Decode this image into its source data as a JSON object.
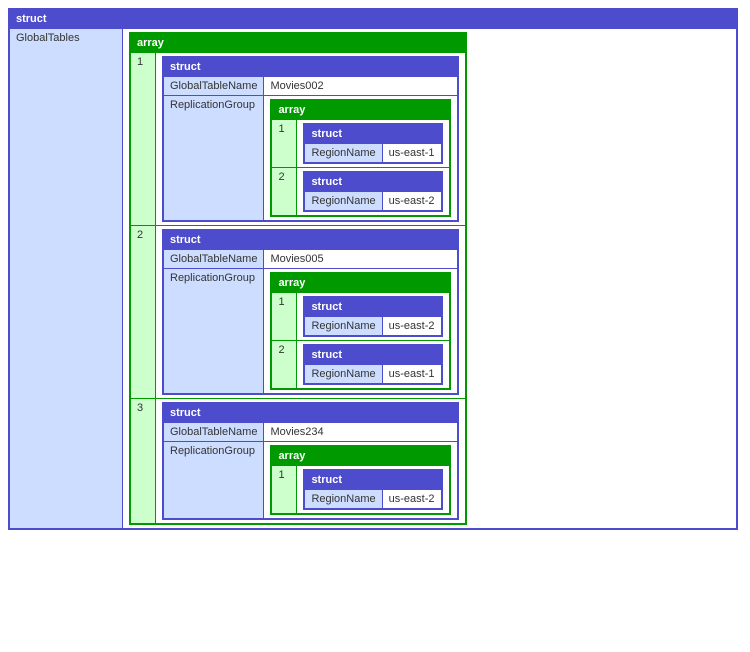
{
  "labels": {
    "struct": "struct",
    "array": "array",
    "globalTables": "GlobalTables",
    "globalTableName": "GlobalTableName",
    "replicationGroup": "ReplicationGroup",
    "regionName": "RegionName"
  },
  "idx": {
    "1": "1",
    "2": "2",
    "3": "3"
  },
  "tables": [
    {
      "name": "Movies002",
      "regions": [
        "us-east-1",
        "us-east-2"
      ]
    },
    {
      "name": "Movies005",
      "regions": [
        "us-east-2",
        "us-east-1"
      ]
    },
    {
      "name": "Movies234",
      "regions": [
        "us-east-2"
      ]
    }
  ]
}
